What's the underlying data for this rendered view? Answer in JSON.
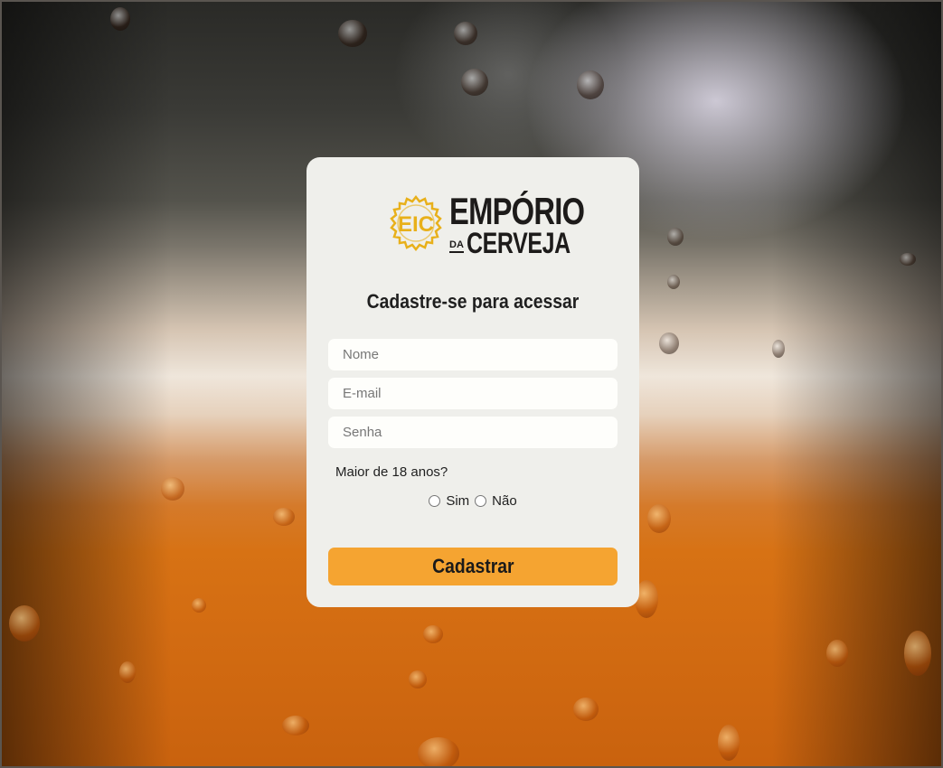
{
  "brand": {
    "logo_mark": "EIC",
    "line1": "EMPÓRIO",
    "line2_prefix": "DA",
    "line2": "CERVEJA",
    "badge_color": "#e8b01a"
  },
  "form": {
    "title": "Cadastre-se para acessar",
    "name_placeholder": "Nome",
    "email_placeholder": "E-mail",
    "password_placeholder": "Senha",
    "age_question": "Maior de 18 anos?",
    "age_options": [
      "Sim",
      "Não"
    ],
    "submit_label": "Cadastrar"
  },
  "colors": {
    "card_bg": "#efefeb",
    "button_bg": "#f5a431",
    "input_bg": "#fefefb"
  }
}
